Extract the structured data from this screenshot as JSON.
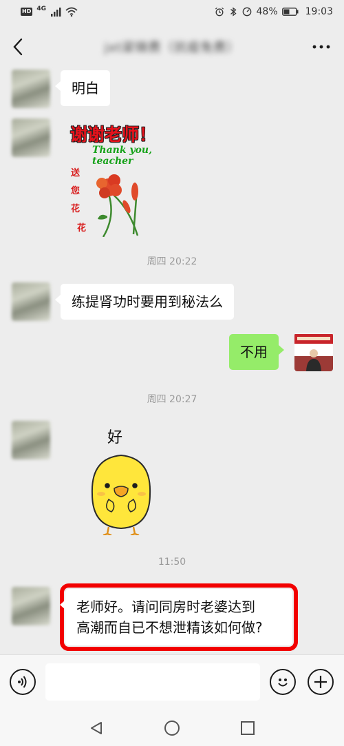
{
  "status_bar": {
    "left_badge": "HD",
    "network": "4G",
    "battery_percent": "48%",
    "time": "19:03"
  },
  "header": {
    "title": "jxt梁锦费（抗疫免费）"
  },
  "messages": {
    "m1_text": "明白",
    "sticker1_title": "谢谢老师！",
    "sticker1_subtitle": "Thank you, teacher",
    "sticker1_vertical": [
      "送",
      "您",
      "花",
      "花"
    ],
    "ts1": "周四 20:22",
    "m2_text": "练提肾功时要用到秘法么",
    "m3_text": "不用",
    "ts2": "周四 20:27",
    "sticker2_label": "好",
    "ts3": "11:50",
    "m4_text_line1": "老师好。请问同房时老婆达到",
    "m4_text_line2": "高潮而自已不想泄精该如何做?"
  },
  "colors": {
    "background": "#ededed",
    "sent_bubble": "#95ec69",
    "received_bubble": "#ffffff",
    "highlight": "#f20000"
  },
  "input_bar": {
    "text_value": "",
    "icons": [
      "voice-icon",
      "emoji-icon",
      "plus-icon"
    ]
  },
  "nav": {
    "icons": [
      "back-triangle-icon",
      "home-circle-icon",
      "recents-square-icon"
    ]
  }
}
